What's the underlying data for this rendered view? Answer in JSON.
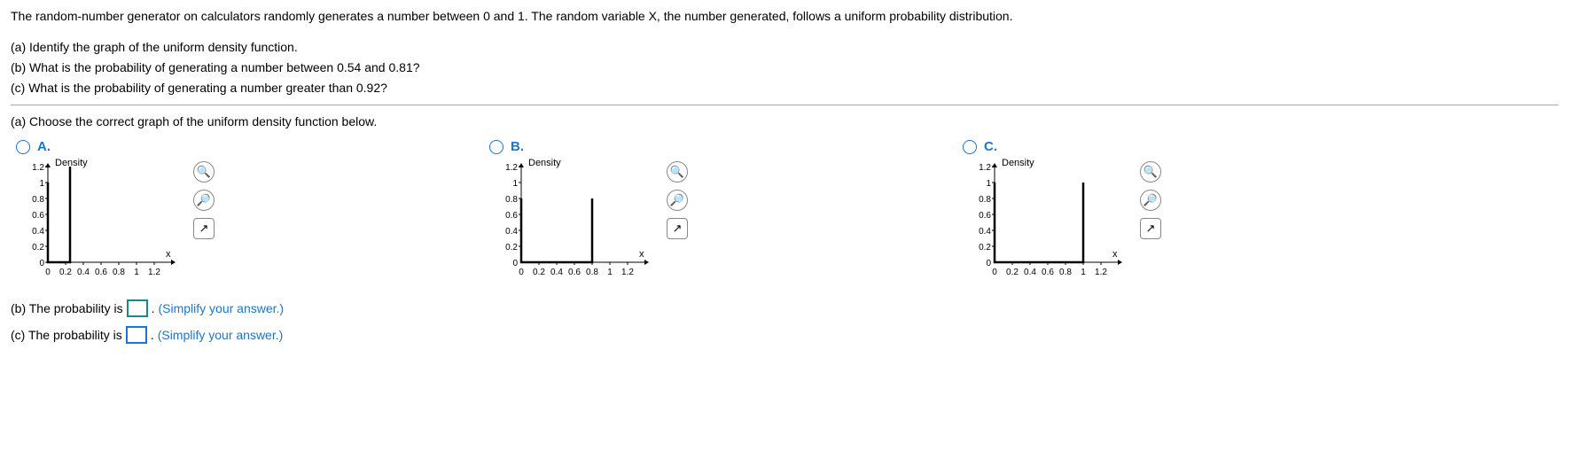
{
  "problem": {
    "intro": "The random-number generator on calculators randomly generates a number between 0 and 1. The random variable X, the number generated, follows a uniform probability distribution.",
    "a": "(a) Identify the graph of the uniform density function.",
    "b": "(b) What is the probability of generating a number between 0.54 and 0.81?",
    "c": "(c) What is the probability of generating a number greater than 0.92?"
  },
  "instruction": "(a) Choose the correct graph of the uniform density function below.",
  "options": {
    "a": {
      "label": "A.",
      "ylabel": "Density",
      "xlabel": "x"
    },
    "b": {
      "label": "B.",
      "ylabel": "Density",
      "xlabel": "x"
    },
    "c": {
      "label": "C.",
      "ylabel": "Density",
      "xlabel": "x"
    }
  },
  "chart_data": [
    {
      "type": "line",
      "title": "Option A",
      "ylabel": "Density",
      "xlabel": "x",
      "xticks": [
        0,
        0.2,
        0.4,
        0.6,
        0.8,
        1,
        1.2
      ],
      "yticks": [
        0,
        0.2,
        0.4,
        0.6,
        0.8,
        1,
        1.2
      ],
      "xlim": [
        0,
        1.2
      ],
      "ylim": [
        0,
        1.2
      ],
      "series": [
        {
          "name": "density",
          "points": [
            [
              0,
              1
            ],
            [
              0,
              0
            ],
            [
              0.25,
              0
            ],
            [
              0.25,
              1.2
            ]
          ]
        }
      ]
    },
    {
      "type": "line",
      "title": "Option B",
      "ylabel": "Density",
      "xlabel": "x",
      "xticks": [
        0,
        0.2,
        0.4,
        0.6,
        0.8,
        1,
        1.2
      ],
      "yticks": [
        0,
        0.2,
        0.4,
        0.6,
        0.8,
        1,
        1.2
      ],
      "xlim": [
        0,
        1.2
      ],
      "ylim": [
        0,
        1.2
      ],
      "series": [
        {
          "name": "density",
          "points": [
            [
              0,
              0.8
            ],
            [
              0,
              0
            ],
            [
              0.8,
              0
            ],
            [
              0.8,
              0.8
            ]
          ]
        }
      ]
    },
    {
      "type": "line",
      "title": "Option C",
      "ylabel": "Density",
      "xlabel": "x",
      "xticks": [
        0,
        0.2,
        0.4,
        0.6,
        0.8,
        1,
        1.2
      ],
      "yticks": [
        0,
        0.2,
        0.4,
        0.6,
        0.8,
        1,
        1.2
      ],
      "xlim": [
        0,
        1.2
      ],
      "ylim": [
        0,
        1.2
      ],
      "series": [
        {
          "name": "density",
          "points": [
            [
              0,
              1
            ],
            [
              0,
              0
            ],
            [
              1,
              0
            ],
            [
              1,
              1
            ]
          ]
        }
      ]
    }
  ],
  "answers": {
    "b_prefix": "(b) The probability is ",
    "b_suffix": ". ",
    "b_hint": "(Simplify your answer.)",
    "c_prefix": "(c) The probability is ",
    "c_suffix": ". ",
    "c_hint": "(Simplify your answer.)"
  },
  "ticks": {
    "x": [
      "0",
      "0.2",
      "0.4",
      "0.6",
      "0.8",
      "1",
      "1.2"
    ],
    "y": [
      "0",
      "0.2",
      "0.4",
      "0.6",
      "0.8",
      "1",
      "1.2"
    ]
  }
}
